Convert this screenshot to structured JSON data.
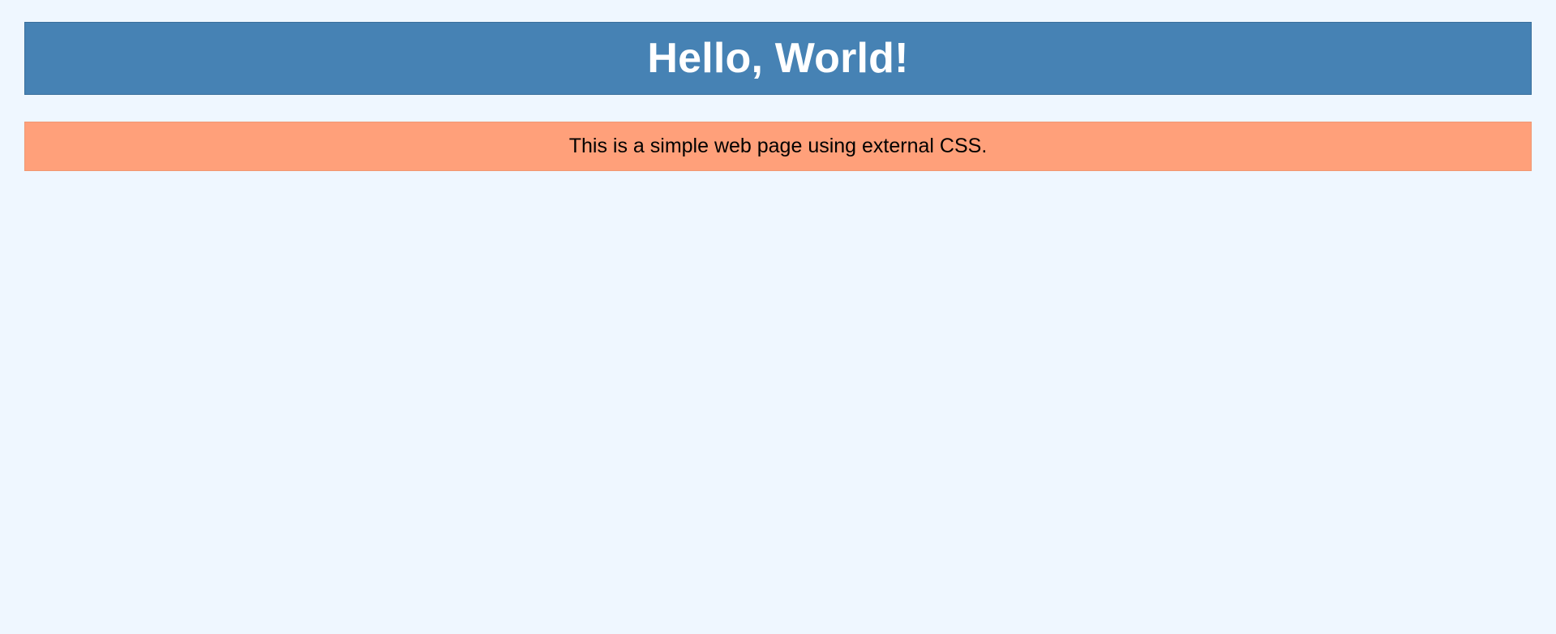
{
  "header": {
    "title": "Hello, World!"
  },
  "content": {
    "message": "This is a simple web page using external CSS."
  },
  "colors": {
    "page_background": "#eff7ff",
    "header_background": "#4682b4",
    "header_text": "#ffffff",
    "message_background": "#ffa07a",
    "message_text": "#000000"
  }
}
